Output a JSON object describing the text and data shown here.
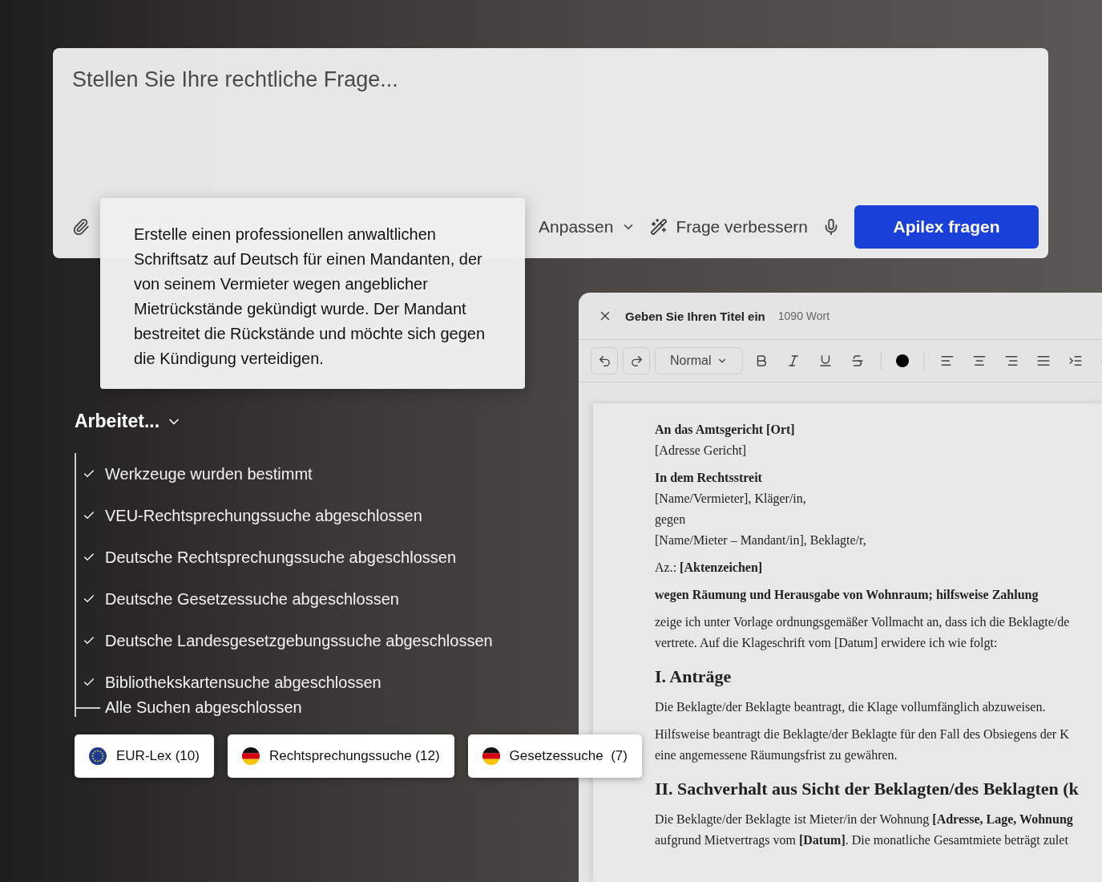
{
  "composer": {
    "placeholder": "Stellen Sie Ihre rechtliche Frage...",
    "customize": "Anpassen",
    "improve": "Frage verbessern",
    "submit": "Apilex fragen"
  },
  "prompt_popup": {
    "text": "Erstelle einen professionellen anwaltlichen Schriftsatz auf Deutsch für einen Mandanten, der von seinem Vermieter wegen angeblicher Mietrückstände gekündigt wurde. Der Mandant bestreitet die Rückstände und möchte sich gegen die Kündigung verteidigen."
  },
  "progress": {
    "title": "Arbeitet...",
    "expanded": true,
    "steps": [
      {
        "label": "Werkzeuge wurden bestimmt",
        "done": true
      },
      {
        "label": "VEU-Rechtsprechungssuche abgeschlossen",
        "done": true
      },
      {
        "label": "Deutsche Rechtsprechungssuche abgeschlossen",
        "done": true
      },
      {
        "label": "Deutsche Gesetzessuche abgeschlossen",
        "done": true
      },
      {
        "label": "Deutsche Landesgesetzgebungssuche abgeschlossen",
        "done": true
      },
      {
        "label": "Bibliothekskartensuche abgeschlossen",
        "done": true
      },
      {
        "label": "Alle Suchen abgeschlossen",
        "done": false
      }
    ]
  },
  "sources": [
    {
      "label": "EUR-Lex (10)",
      "kind": "eu"
    },
    {
      "label": "Rechtsprechungssuche (12)",
      "kind": "de"
    },
    {
      "label": "Gesetzessuche  (7)",
      "kind": "de"
    }
  ],
  "editor": {
    "title": "Geben Sie Ihren Titel ein",
    "word_count": "1090 Wort",
    "style": "Normal",
    "document": [
      {
        "kind": "bold",
        "text": "An das Amtsgericht [Ort]"
      },
      {
        "kind": "line",
        "text": "[Adresse Gericht]"
      },
      {
        "kind": "bold",
        "text": "In dem Rechtsstreit"
      },
      {
        "kind": "line",
        "text": "[Name/Vermieter], Kläger/in,"
      },
      {
        "kind": "line",
        "text": "gegen"
      },
      {
        "kind": "line",
        "text": "[Name/Mieter – Mandant/in], Beklagte/r,"
      },
      {
        "kind": "para",
        "text": "Az.: **[Aktenzeichen]**"
      },
      {
        "kind": "bold",
        "text": "wegen Räumung und Herausgabe von Wohnraum; hilfsweise Zahlung"
      },
      {
        "kind": "para",
        "text": "zeige ich unter Vorlage ordnungsgemäßer Vollmacht an, dass ich die Beklagte/de"
      },
      {
        "kind": "line",
        "text": "vertrete. Auf die Klageschrift vom [Datum] erwidere ich wie folgt:"
      },
      {
        "kind": "heading",
        "text": "I. Anträge"
      },
      {
        "kind": "para",
        "text": "Die Beklagte/der Beklagte beantragt, die Klage vollumfänglich abzuweisen."
      },
      {
        "kind": "para",
        "text": "Hilfsweise beantragt die Beklagte/der Beklagte für den Fall des Obsiegens der K"
      },
      {
        "kind": "line",
        "text": "eine angemessene Räumungsfrist zu gewähren."
      },
      {
        "kind": "heading",
        "text": "II. Sachverhalt aus Sicht der Beklagten/des Beklagten (k"
      },
      {
        "kind": "para",
        "text": "Die Beklagte/der Beklagte ist Mieter/in der Wohnung **[Adresse, Lage, Wohnung**"
      },
      {
        "kind": "line",
        "text": "aufgrund Mietvertrags vom **[Datum]**. Die monatliche Gesamtmiete beträgt zulet"
      }
    ]
  }
}
